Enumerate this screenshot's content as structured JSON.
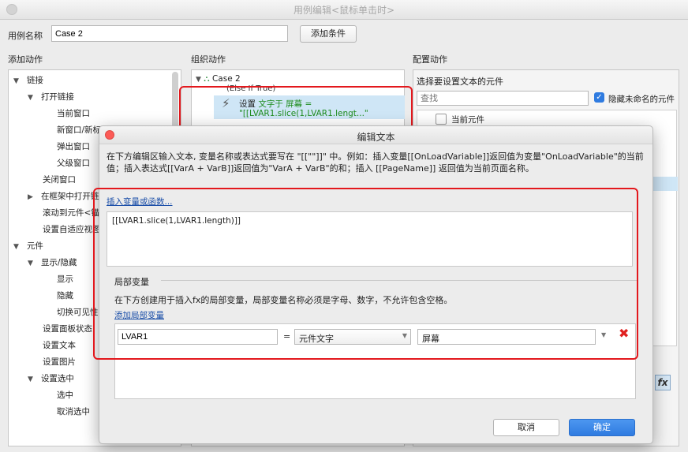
{
  "window": {
    "title": "用例编辑<鼠标单击时>"
  },
  "case_name": {
    "label": "用例名称",
    "value": "Case 2",
    "add_condition": "添加条件"
  },
  "columns": {
    "add_actions": "添加动作",
    "organize_actions": "组织动作",
    "configure_actions": "配置动作"
  },
  "action_tree": [
    "链接",
    "打开链接",
    "当前窗口",
    "新窗口/新标签",
    "弹出窗口",
    "父级窗口",
    "关闭窗口",
    "在框架中打开链接",
    "滚动到元件<锚",
    "设置自适应视图",
    "元件",
    "显示/隐藏",
    "显示",
    "隐藏",
    "切换可见性",
    "设置面板状态",
    "设置文本",
    "设置图片",
    "设置选中",
    "选中",
    "取消选中"
  ],
  "organize": {
    "case": "Case 2",
    "condition": "(Else If True)",
    "action_prefix": "设置",
    "action_text": "文字于 屏幕 =",
    "action_value": "\"[[LVAR1.slice(1,LVAR1.lengt...\""
  },
  "configure": {
    "heading": "选择要设置文本的元件",
    "search_placeholder": "查找",
    "hide_unnamed": "隐藏未命名的元件",
    "current_widget": "当前元件"
  },
  "dialog": {
    "title": "编辑文本",
    "instructions": "在下方编辑区输入文本, 变量名称或表达式要写在 \"[[\"\"]]\" 中。例如：插入变量[[OnLoadVariable]]返回值为变量\"OnLoadVariable\"的当前值；插入表达式[[VarA + VarB]]返回值为\"VarA + VarB\"的和；插入 [[PageName]] 返回值为当前页面名称。",
    "insert_link": "插入变量或函数...",
    "editor_text": "[[LVAR1.slice(1,LVAR1.length)]]",
    "local_vars_title": "局部变量",
    "local_vars_desc": "在下方创建用于插入fx的局部变量，局部变量名称必须是字母、数字，不允许包含空格。",
    "add_local_var": "添加局部变量",
    "var_name": "LVAR1",
    "equals": "=",
    "var_type": "元件文字",
    "var_target": "屏幕",
    "cancel": "取消",
    "ok": "确定"
  },
  "fx_label": "fx",
  "colors": {
    "highlight": "#e3181d",
    "primary_button": "#2f7be0",
    "selection": "#cfe6f6",
    "action_green": "#1e8c1e"
  }
}
